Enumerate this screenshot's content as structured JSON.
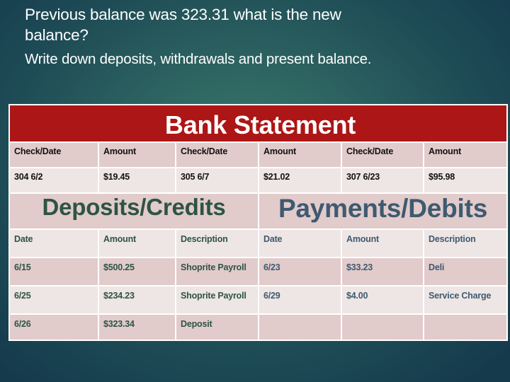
{
  "question": {
    "line1": "Previous balance was 323.31 what is the new balance?",
    "line2": "Write down deposits, withdrawals and present balance."
  },
  "statement": {
    "title": "Bank Statement",
    "checks": {
      "headers": [
        "Check/Date",
        "Amount",
        "Check/Date",
        "Amount",
        "Check/Date",
        "Amount"
      ],
      "row": [
        "304 6/2",
        "$19.45",
        "305 6/7",
        "$21.02",
        "307 6/23",
        "$95.98"
      ]
    },
    "deposits": {
      "title": "Deposits/Credits",
      "headers": [
        "Date",
        "Amount",
        "Description"
      ],
      "rows": [
        [
          "6/15",
          "$500.25",
          "Shoprite Payroll"
        ],
        [
          "6/25",
          "$234.23",
          "Shoprite Payroll"
        ],
        [
          "6/26",
          "$323.34",
          "Deposit"
        ]
      ]
    },
    "payments": {
      "title": "Payments/Debits",
      "headers": [
        "Date",
        "Amount",
        "Description"
      ],
      "rows": [
        [
          "6/23",
          "$33.23",
          "Deli"
        ],
        [
          "6/29",
          "$4.00",
          "Service Charge"
        ],
        [
          "",
          "",
          ""
        ]
      ]
    }
  },
  "colors": {
    "title_bar": "#ad1616",
    "header_row": "#e2cbcb",
    "light_row": "#eee5e5",
    "deposits_text": "#2d5444",
    "payments_text": "#3e5a70"
  }
}
